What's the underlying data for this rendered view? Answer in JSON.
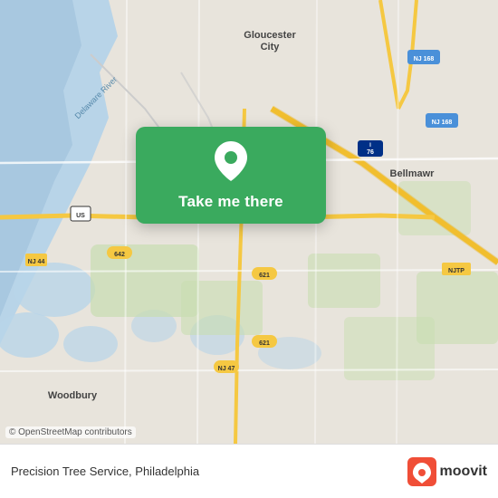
{
  "map": {
    "alt": "Map of Philadelphia area",
    "copyright": "© OpenStreetMap contributors"
  },
  "card": {
    "label": "Take me there",
    "pin_icon": "location-pin-icon"
  },
  "bottom_bar": {
    "location_text": "Precision Tree Service, Philadelphia",
    "logo_text": "moovit"
  },
  "colors": {
    "card_bg": "#3aaa5e",
    "card_text": "#ffffff",
    "bottom_bg": "#ffffff",
    "bottom_text": "#333333"
  }
}
